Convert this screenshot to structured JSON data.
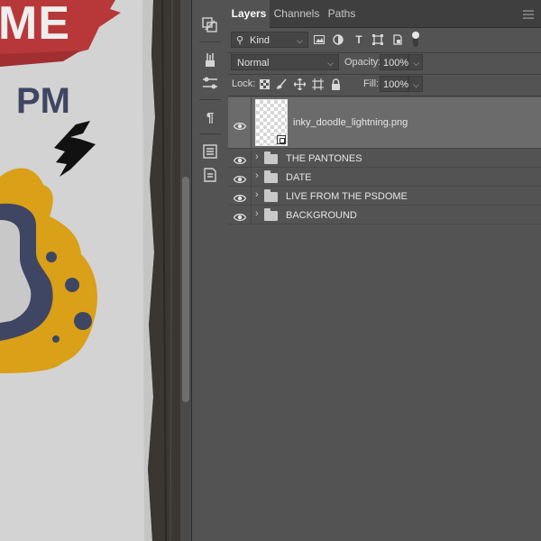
{
  "canvas": {
    "artwork_text_1": "ME",
    "artwork_text_2": "PM"
  },
  "tool_strip": {
    "icons": [
      "libraries-icon",
      "brushes-icon",
      "adjust-icon",
      "paragraph-icon",
      "properties-icon",
      "notes-icon"
    ]
  },
  "tabs": {
    "layers": "Layers",
    "channels": "Channels",
    "paths": "Paths"
  },
  "filter": {
    "kind_label": "Kind",
    "icons": [
      "image-filter-icon",
      "adjustment-filter-icon",
      "type-filter-icon",
      "shape-filter-icon",
      "smartobject-filter-icon"
    ]
  },
  "blend": {
    "mode": "Normal",
    "opacity_label": "Opacity:",
    "opacity_value": "100%"
  },
  "lock": {
    "label": "Lock:",
    "fill_label": "Fill:",
    "fill_value": "100%"
  },
  "layers": [
    {
      "name": "inky_doodle_lightning.png",
      "type": "smart-object",
      "visible": true,
      "selected": true
    },
    {
      "name": "THE PANTONES",
      "type": "group",
      "visible": true,
      "selected": false
    },
    {
      "name": "DATE",
      "type": "group",
      "visible": true,
      "selected": false
    },
    {
      "name": "LIVE FROM THE PSDOME",
      "type": "group",
      "visible": true,
      "selected": false
    },
    {
      "name": "BACKGROUND",
      "type": "group",
      "visible": true,
      "selected": false
    }
  ],
  "colors": {
    "panel_bg": "#535353",
    "selected_row": "#6b6b6b",
    "art_yellow": "#d9a018",
    "art_navy": "#3e4663",
    "art_red": "#b8383a"
  }
}
